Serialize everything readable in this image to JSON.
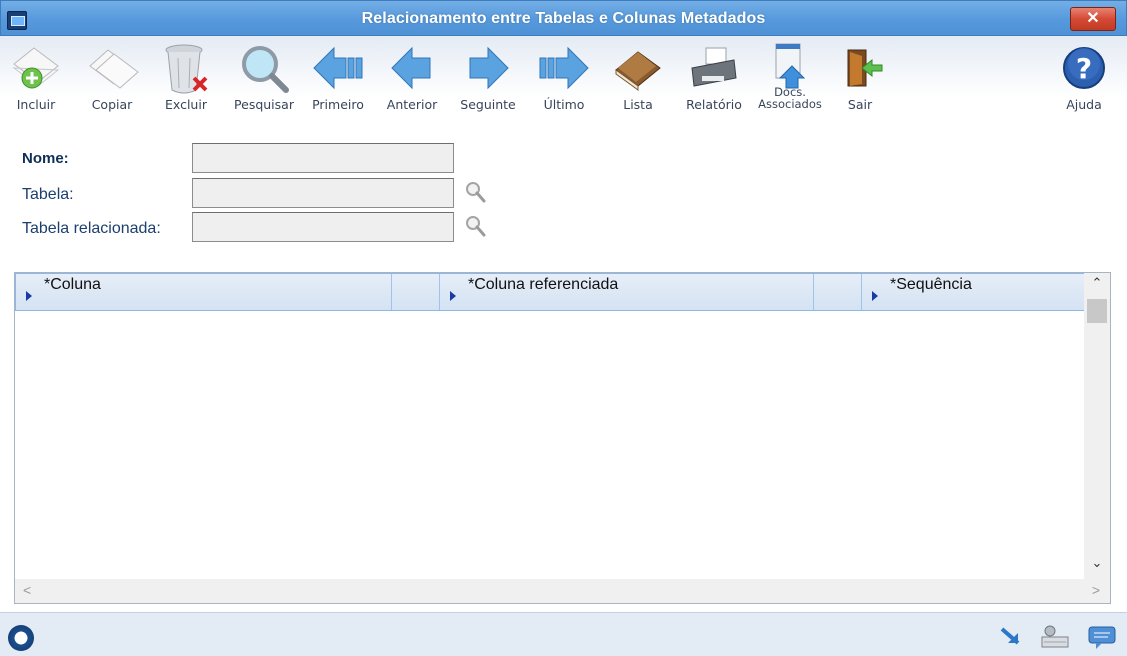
{
  "window": {
    "title": "Relacionamento entre Tabelas e Colunas Metadados",
    "close_label": "✕"
  },
  "toolbar": {
    "buttons": [
      {
        "label": "Incluir",
        "icon": "add-document-icon"
      },
      {
        "label": "Copiar",
        "icon": "copy-icon"
      },
      {
        "label": "Excluir",
        "icon": "trash-icon"
      },
      {
        "label": "Pesquisar",
        "icon": "magnifier-icon"
      },
      {
        "label": "Primeiro",
        "icon": "first-record-icon"
      },
      {
        "label": "Anterior",
        "icon": "previous-record-icon"
      },
      {
        "label": "Seguinte",
        "icon": "next-record-icon"
      },
      {
        "label": "Último",
        "icon": "last-record-icon"
      },
      {
        "label": "Lista",
        "icon": "book-icon"
      },
      {
        "label": "Relatório",
        "icon": "printer-icon"
      },
      {
        "label": "Docs. Associados",
        "icon": "upload-document-icon"
      },
      {
        "label": "Sair",
        "icon": "exit-door-icon"
      },
      {
        "label": "Ajuda",
        "icon": "help-icon"
      }
    ]
  },
  "form": {
    "nome_label": "Nome:",
    "nome_value": "",
    "tabela_label": "Tabela:",
    "tabela_value": "",
    "tabela_relacionada_label": "Tabela relacionada:",
    "tabela_relacionada_value": ""
  },
  "grid": {
    "columns": [
      "*Coluna",
      "",
      "*Coluna referenciada",
      "",
      "*Sequência"
    ],
    "rows": [],
    "scroll_up": "⌃",
    "scroll_down": "⌄",
    "scroll_left": "<",
    "scroll_right": ">"
  },
  "statusbar": {
    "icons": [
      "app-logo-icon",
      "resize-arrow-icon",
      "keyboard-settings-icon",
      "chat-bubble-icon"
    ]
  },
  "colors": {
    "titlebar": "#5699dc",
    "close_button": "#d44a35",
    "header_border": "#8fb8e6",
    "label_text": "#1c3f6e"
  }
}
